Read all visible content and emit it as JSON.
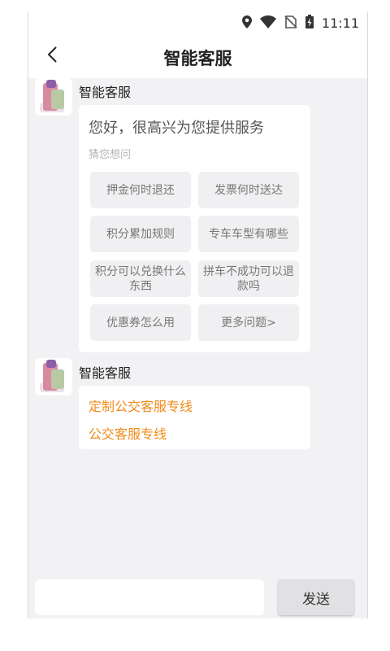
{
  "status_bar": {
    "time": "11:11",
    "icons": [
      "location-icon",
      "wifi-icon",
      "no-sim-icon",
      "battery-charging-icon"
    ]
  },
  "header": {
    "title": "智能客服",
    "back_icon": "chevron-left-icon"
  },
  "messages": [
    {
      "sender": "智能客服",
      "greeting": "您好，很高兴为您提供服务",
      "guess_label": "猜您想问",
      "questions": [
        "押金何时退还",
        "发票何时送达",
        "积分累加规则",
        "专车车型有哪些",
        "积分可以兑换什么东西",
        "拼车不成功可以退款吗",
        "优惠券怎么用",
        "更多问题>"
      ]
    },
    {
      "sender": "智能客服",
      "links": [
        "定制公交客服专线",
        "公交客服专线"
      ]
    }
  ],
  "footer": {
    "input_placeholder": "",
    "send_label": "发送"
  },
  "colors": {
    "link": "#f08a1a",
    "background": "#f2f2f4",
    "bubble": "#ffffff"
  }
}
